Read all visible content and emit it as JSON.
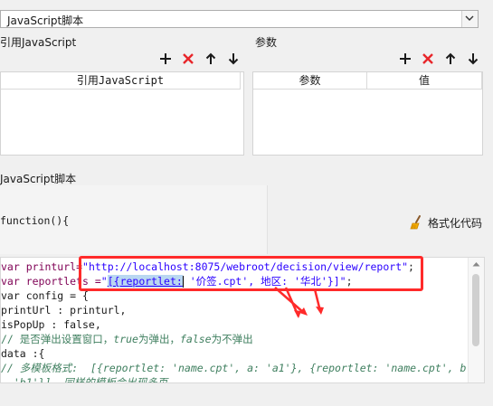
{
  "type_select": {
    "value": "JavaScript脚本"
  },
  "ref_js": {
    "title": "引用JavaScript",
    "column_header": "引用JavaScript"
  },
  "params": {
    "title": "参数",
    "columns": [
      "参数",
      "值"
    ]
  },
  "script_section": {
    "title": "JavaScript脚本",
    "function_header": "function(){",
    "format_button": "格式化代码"
  },
  "code": {
    "lines": [
      {
        "pre": "var printurl=",
        "str": "\"http://localhost:8075/webroot/decision/view/report\"",
        "post": ";"
      },
      {
        "pre": "var reportlets =",
        "str_open": "\"",
        "sel": "[{reportlet:",
        "str_rest": " '价签.cpt', 地区: '华北'}]\"",
        "post": ";"
      },
      {
        "text": "var config = {"
      },
      {
        "text": "printUrl : printurl,"
      },
      {
        "text": "isPopUp : false,"
      },
      {
        "comment": "// 是否弹出设置窗口，",
        "c1": "true",
        "c2": "为弹出，",
        "c3": "false",
        "c4": "为不弹出"
      },
      {
        "text": "data :{"
      },
      {
        "comment": "// 多模板格式:  [{reportlet: 'name.cpt', a: 'a1'}, {reportlet: 'name.cpt', b"
      },
      {
        "comment": "  'b1'}], 同样的模板会出现多页"
      }
    ]
  },
  "colors": {
    "annotation": "#ff2a2a",
    "keyword": "#7f0055",
    "string": "#2a00ff",
    "comment": "#3f7f5f"
  },
  "icons": [
    "add-icon",
    "delete-icon",
    "move-up-icon",
    "move-down-icon",
    "broom-icon",
    "dropdown-arrow-icon"
  ]
}
